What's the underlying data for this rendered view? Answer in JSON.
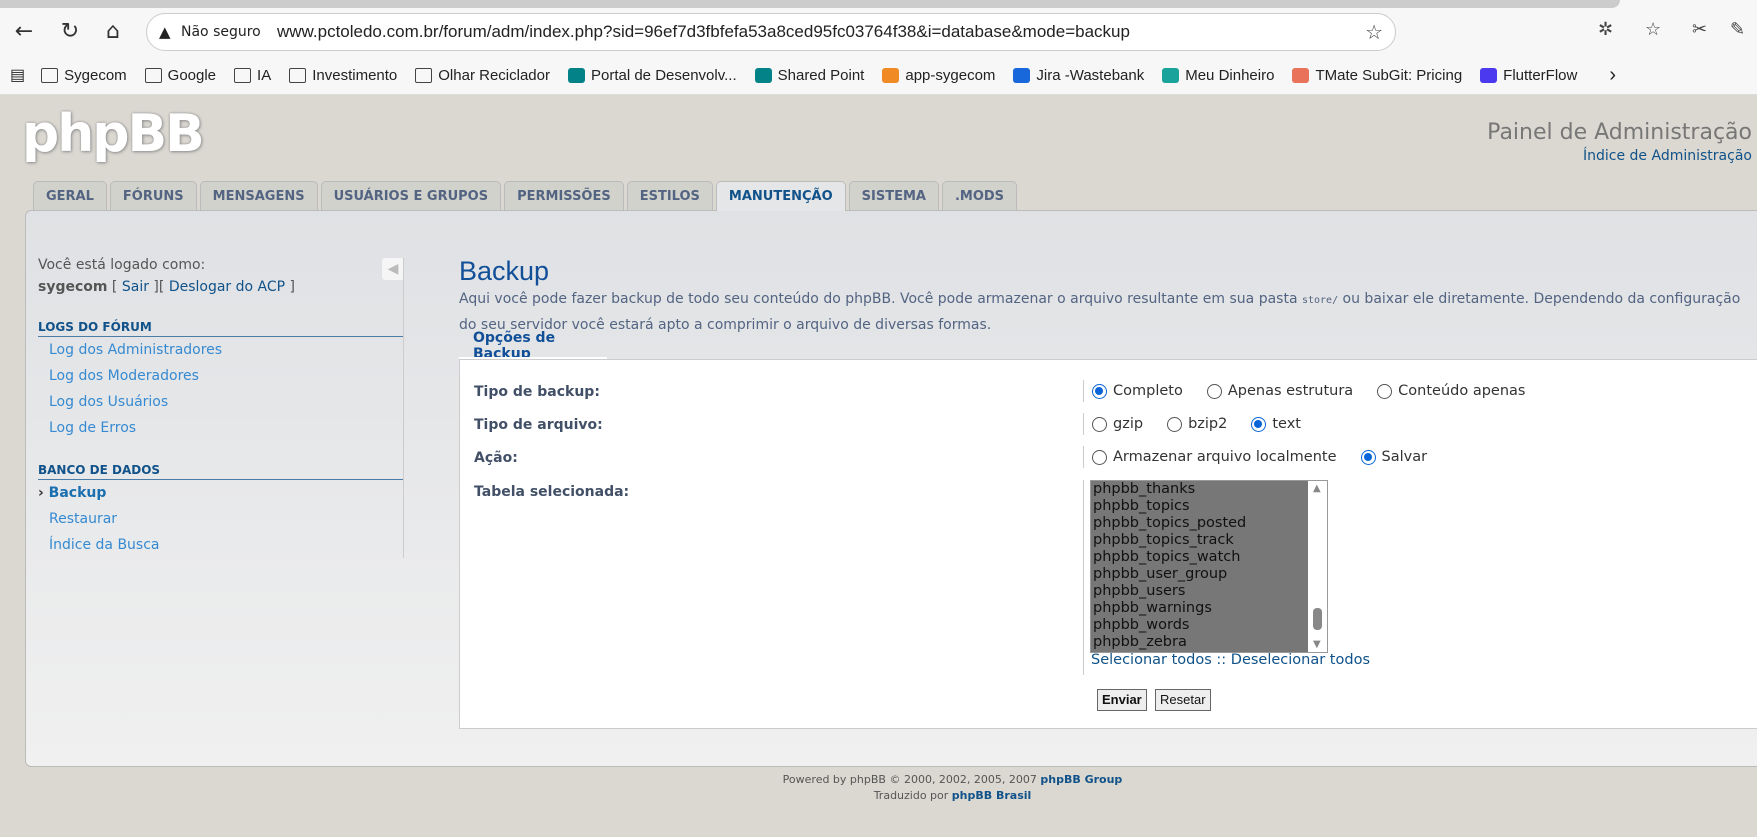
{
  "browser": {
    "security": "Não seguro",
    "url": "www.pctoledo.com.br/forum/adm/index.php?sid=96ef7d3fbfefa53a8ced95fc03764f38&i=database&mode=backup",
    "bookmarks": [
      {
        "label": "Sygecom",
        "icon": "folder"
      },
      {
        "label": "Google",
        "icon": "folder"
      },
      {
        "label": "IA",
        "icon": "folder"
      },
      {
        "label": "Investimento",
        "icon": "folder"
      },
      {
        "label": "Olhar Reciclador",
        "icon": "folder"
      },
      {
        "label": "Portal de Desenvolv...",
        "icon": "sharepoint",
        "color": "#038387"
      },
      {
        "label": "Shared Point",
        "icon": "sharepoint",
        "color": "#038387"
      },
      {
        "label": "app-sygecom",
        "icon": "app",
        "color": "#f08a24"
      },
      {
        "label": "Jira -Wastebank",
        "icon": "jira",
        "color": "#1868db"
      },
      {
        "label": "Meu Dinheiro",
        "icon": "leaf",
        "color": "#1aa39a"
      },
      {
        "label": "TMate SubGit: Pricing",
        "icon": "tmate",
        "color": "#e8735a"
      },
      {
        "label": "FlutterFlow",
        "icon": "flutterflow",
        "color": "#4b39ef"
      }
    ]
  },
  "header": {
    "logo": "phpBB",
    "title": "Painel de Administração",
    "index_link": "Índice de Administração"
  },
  "tabs": [
    "GERAL",
    "FÓRUNS",
    "MENSAGENS",
    "USUÁRIOS E GRUPOS",
    "PERMISSÕES",
    "ESTILOS",
    "MANUTENÇÃO",
    "SISTEMA",
    ".MODS"
  ],
  "sidebar": {
    "logged_as": "Você está logado como:",
    "username": "sygecom",
    "logout": "Sair",
    "acp_logout": "Deslogar do  ACP",
    "sections": [
      {
        "title": "LOGS DO FÓRUM",
        "items": [
          "Log dos Administradores",
          "Log dos Moderadores",
          "Log dos Usuários",
          "Log de Erros"
        ]
      },
      {
        "title": "BANCO DE DADOS",
        "items": [
          "Backup",
          "Restaurar",
          "Índice da Busca"
        ]
      }
    ]
  },
  "main": {
    "title": "Backup",
    "desc1": "Aqui você pode fazer backup de todo seu conteúdo do phpBB. Você pode armazenar o arquivo resultante em sua pasta ",
    "desc_code": "store/",
    "desc2": " ou baixar ele diretamente. Dependendo da configuração do",
    "desc3": "seu servidor você estará apto a comprimir o arquivo de diversas formas.",
    "legend": "Opções de Backup",
    "backup_type": {
      "label": "Tipo de backup:",
      "options": [
        "Completo",
        "Apenas estrutura",
        "Conteúdo apenas"
      ],
      "selected": "Completo"
    },
    "file_type": {
      "label": "Tipo de arquivo:",
      "options": [
        "gzip",
        "bzip2",
        "text"
      ],
      "selected": "text"
    },
    "action": {
      "label": "Ação:",
      "options": [
        "Armazenar arquivo localmente",
        "Salvar"
      ],
      "selected": "Salvar"
    },
    "tables": {
      "label": "Tabela selecionada:",
      "visible": [
        "phpbb_thanks",
        "phpbb_topics",
        "phpbb_topics_posted",
        "phpbb_topics_track",
        "phpbb_topics_watch",
        "phpbb_user_group",
        "phpbb_users",
        "phpbb_warnings",
        "phpbb_words",
        "phpbb_zebra"
      ],
      "select_all": "Selecionar todos",
      "sep": " :: ",
      "deselect_all": "Deselecionar todos"
    },
    "submit": "Enviar",
    "reset": "Resetar"
  },
  "footer": {
    "line1": "Powered by phpBB © 2000, 2002, 2005, 2007 ",
    "group": "phpBB Group",
    "line2": "Traduzido por ",
    "brasil": "phpBB Brasil"
  }
}
